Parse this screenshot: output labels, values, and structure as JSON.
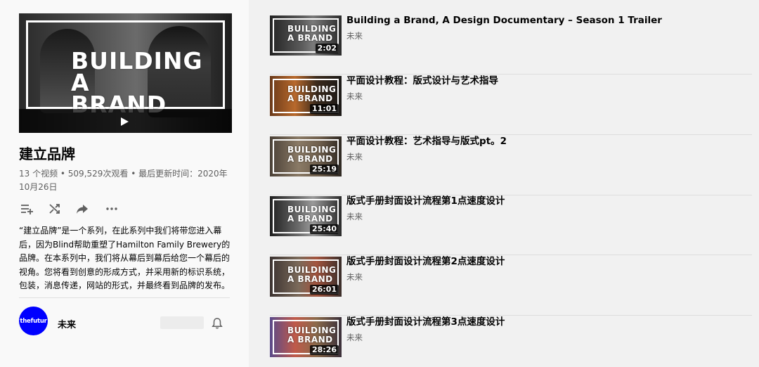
{
  "playlist": {
    "hero_title_line1": "BUILDING",
    "hero_title_line2": "A BRAND",
    "title": "建立品牌",
    "stats": "13 个视频 • 509,529次观看 • 最后更新时间：2020年10月26日",
    "description": "“建立品牌”是一个系列，在此系列中我们将带您进入幕后，因为Blind帮助重塑了Hamilton Family Brewery的品牌。在本系列中，我们将从幕后到幕后给您一个幕后的视角。您将看到创意的形成方式，并采用新的标识系统，包装，消息传递，网站的形式，并最终看到品牌的发布。",
    "actions": [
      {
        "icon": "add-to-queue-icon"
      },
      {
        "icon": "shuffle-icon"
      },
      {
        "icon": "share-icon"
      },
      {
        "icon": "more-icon"
      }
    ]
  },
  "channel": {
    "avatar_text": "thefutur",
    "name": "未来",
    "avatar_color": "#0000ff"
  },
  "thumb_text": {
    "line1": "BUILDING",
    "line2": "A BRAND"
  },
  "videos": [
    {
      "title": "Building a Brand, A Design Documentary – Season 1 Trailer",
      "channel": "未来",
      "duration": "2:02",
      "tone": "bw"
    },
    {
      "title": "平面设计教程：版式设计与艺术指导",
      "channel": "未来",
      "duration": "11:01",
      "tone": "warm"
    },
    {
      "title": "平面设计教程：艺术指导与版式pt。2",
      "channel": "未来",
      "duration": "25:19",
      "tone": "office"
    },
    {
      "title": "版式手册封面设计流程第1点速度设计",
      "channel": "未来",
      "duration": "25:40",
      "tone": "bw"
    },
    {
      "title": "版式手册封面设计流程第2点速度设计",
      "channel": "未来",
      "duration": "26:01",
      "tone": "office"
    },
    {
      "title": "版式手册封面设计流程第3点速度设计",
      "channel": "未来",
      "duration": "28:26",
      "tone": "desk"
    }
  ]
}
